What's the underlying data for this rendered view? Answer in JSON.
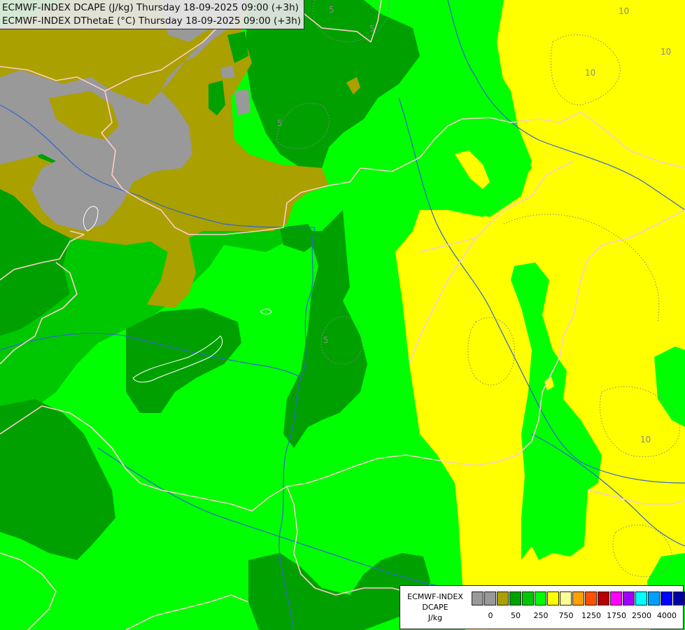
{
  "header": {
    "line1": "ECMWF-INDEX DCAPE (J/kg) Thursday 18-09-2025 09:00 (+3h)",
    "line2": "ECMWF-INDEX DThetaE (°C) Thursday 18-09-2025 09:00 (+3h)"
  },
  "legend": {
    "model": "ECMWF-INDEX",
    "variable": "DCAPE",
    "unit": "J/kg",
    "swatch_colors": [
      "#999999",
      "#999999",
      "#aaa000",
      "#00a000",
      "#00c800",
      "#00ff00",
      "#ffff00",
      "#ffff99",
      "#ffa000",
      "#ff5000",
      "#b40000",
      "#ff00ff",
      "#a000ff",
      "#00ffff",
      "#00a0ff",
      "#0000ff",
      "#0000a0"
    ],
    "tick_labels": [
      "0",
      "50",
      "250",
      "750",
      "1250",
      "1750",
      "2500",
      "4000"
    ]
  },
  "contour_labels": [
    "5",
    "5",
    "5",
    "5",
    "10",
    "10",
    "10",
    "10"
  ],
  "palette": {
    "grey": "#999999",
    "olive": "#aaa000",
    "dark_green": "#00a000",
    "mid_green": "#00c800",
    "bright_green": "#00ff00",
    "yellow": "#ffff00",
    "border_line": "#ffcccc",
    "river_line": "#3366cc",
    "lake_outline": "#ffffff",
    "contour_line": "#888888"
  }
}
